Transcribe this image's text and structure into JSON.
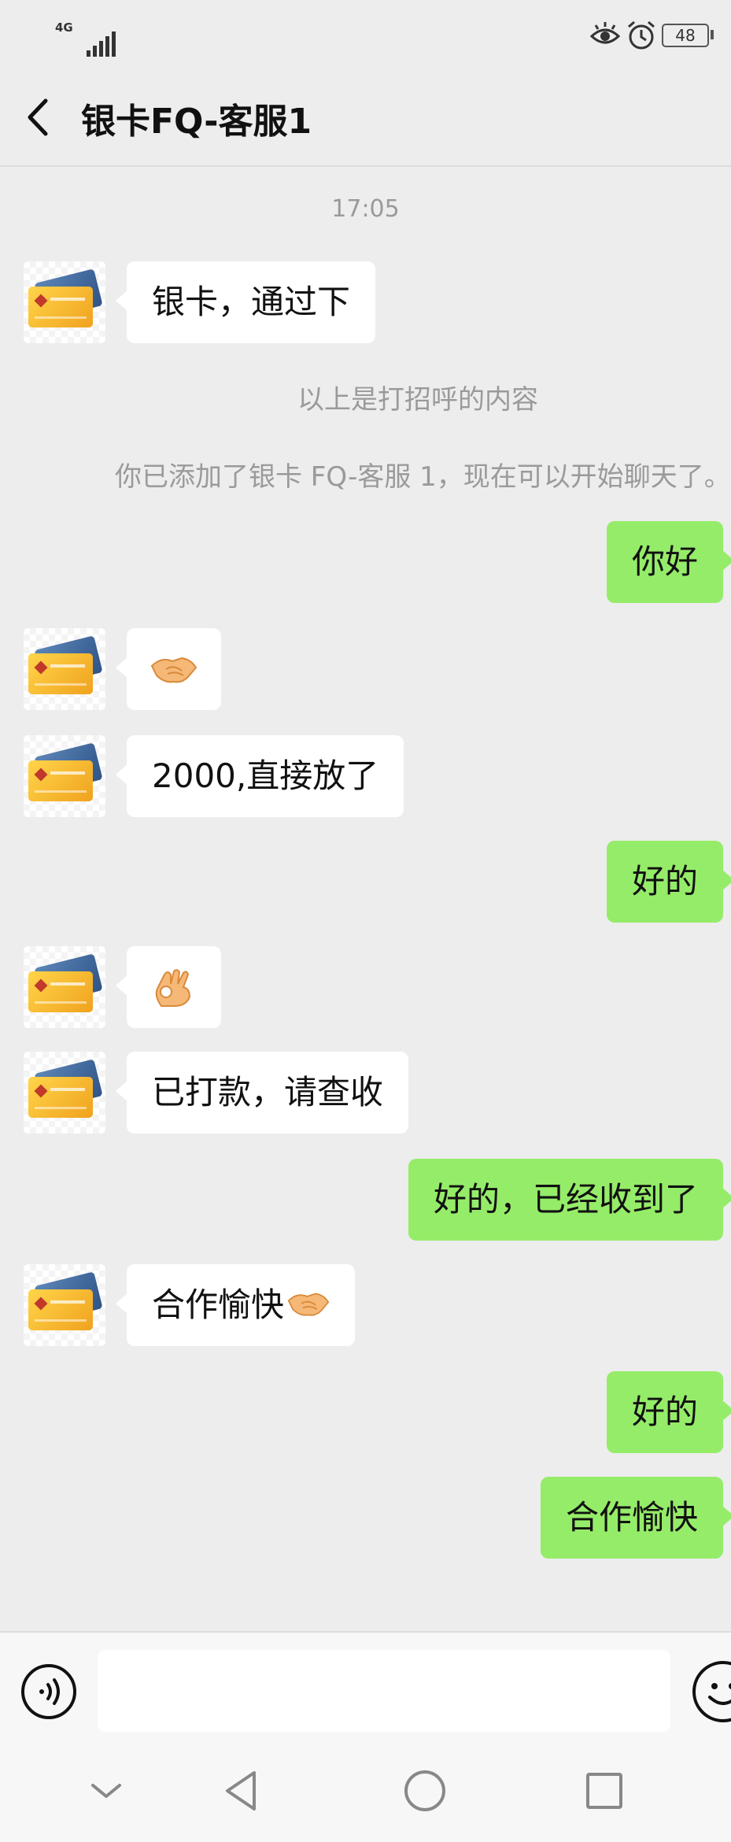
{
  "status_bar": {
    "network": "4G",
    "battery": "48",
    "icons": [
      "signal-icon",
      "eye-icon",
      "alarm-icon",
      "battery-icon"
    ]
  },
  "header": {
    "title": "银卡FQ-客服1",
    "back_icon": "chevron-left-icon"
  },
  "chat": {
    "time": "17:05",
    "system_messages": {
      "greeting_note": "以上是打招呼的内容",
      "added_note": "你已添加了银卡 FQ-客服 1，现在可以开始聊天了。"
    },
    "messages": [
      {
        "side": "in",
        "text": "银卡，通过下"
      },
      {
        "side": "out",
        "text": "你好"
      },
      {
        "side": "in",
        "emoji": "handshake-emoji"
      },
      {
        "side": "in",
        "text": "2000,直接放了"
      },
      {
        "side": "out",
        "text": "好的"
      },
      {
        "side": "in",
        "emoji": "ok-hand-emoji"
      },
      {
        "side": "in",
        "text": "已打款，请查收"
      },
      {
        "side": "out",
        "text": "好的，已经收到了"
      },
      {
        "side": "in",
        "text": "合作愉快",
        "emoji": "handshake-emoji"
      },
      {
        "side": "out",
        "text": "好的"
      },
      {
        "side": "out",
        "text": "合作愉快"
      }
    ]
  },
  "input_bar": {
    "value": "",
    "placeholder": "",
    "icons": [
      "voice-icon",
      "emoji-icon"
    ]
  },
  "nav_bar": {
    "icons": [
      "hide-keyboard-icon",
      "back-triangle-icon",
      "home-circle-icon",
      "recents-square-icon"
    ]
  },
  "colors": {
    "background": "#ededed",
    "incoming_bubble": "#ffffff",
    "outgoing_bubble": "#95ec69",
    "system_text": "#9a9a9a"
  }
}
